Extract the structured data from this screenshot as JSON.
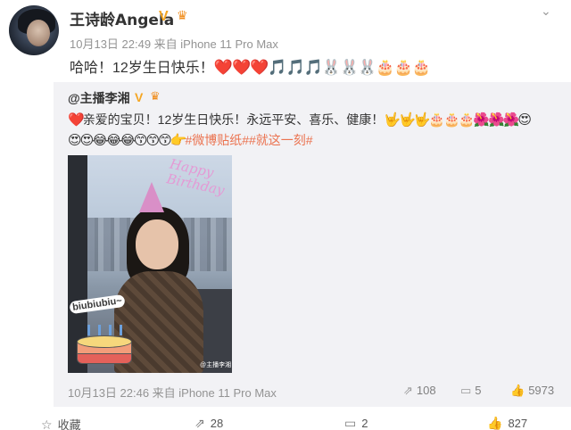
{
  "author": {
    "name": "王诗龄Angela",
    "verified_badge": "V",
    "meta": "10月13日 22:49 来自 iPhone 11 Pro Max"
  },
  "post": {
    "text": "哈哈！12岁生日快乐！",
    "emoji": "❤️❤️❤️🎵🎵🎵🐰🐰🐰🎂🎂🎂"
  },
  "repost": {
    "user": "@主播李湘",
    "verified_badge": "V",
    "line1_emoji_heart": "❤️",
    "line1_text": "亲爱的宝贝！12岁生日快乐！永远平安、喜乐、健康！",
    "line1_emoji_tail": "🤟🤟🤟🎂🎂🎂🌺🌺🌺😍",
    "line2_emoji": "😍😍😂😂😂😙😙😙👉",
    "tags": "#微博贴纸##就这一刻#",
    "photo": {
      "sticker_text_1": "Happy",
      "sticker_text_2": "Birthday",
      "biu_text": "biubiubiu~",
      "watermark": "@主播李湘"
    },
    "meta": "10月13日 22:46 来自 iPhone 11 Pro Max",
    "reposts": "108",
    "comments": "5",
    "likes": "5973"
  },
  "actions": {
    "favorite": "收藏",
    "repost": "28",
    "comment": "2",
    "like": "827"
  },
  "icons": {
    "menu": "chevron-down-icon",
    "repost": "repost-icon",
    "comment": "comment-icon",
    "like": "thumb-up-icon",
    "favorite": "star-icon"
  },
  "colors": {
    "tag": "#eb7350",
    "badge": "#f5a623",
    "repost_bg": "#f2f2f5"
  }
}
